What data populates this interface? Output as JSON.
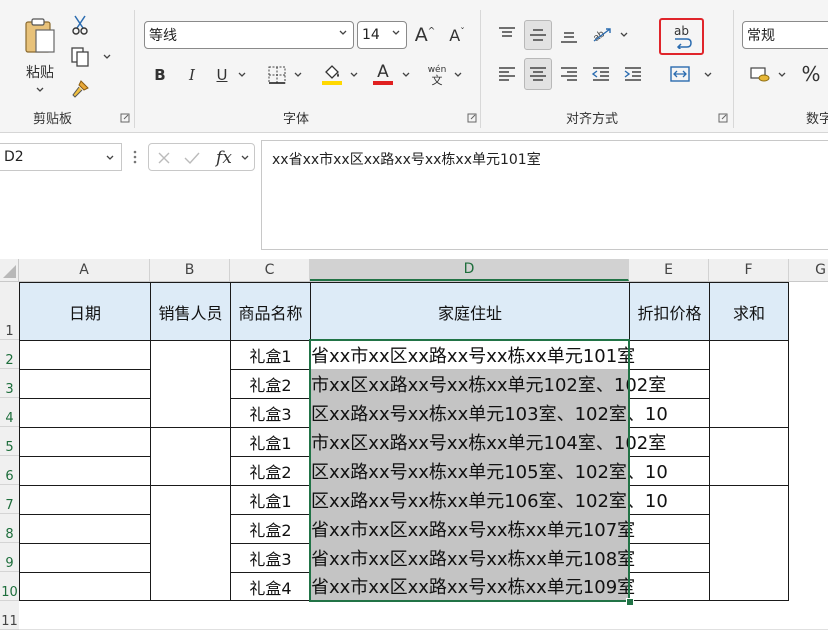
{
  "ribbon": {
    "clipboard": {
      "paste_label": "粘贴",
      "group_label": "剪贴板"
    },
    "font": {
      "font_name": "等线",
      "font_size": "14",
      "phonetic_top": "wén",
      "phonetic_bottom": "文",
      "group_label": "字体"
    },
    "alignment": {
      "wrap_text_icon_text": "ab",
      "group_label": "对齐方式"
    },
    "number": {
      "format": "常规",
      "group_label": "数字",
      "percent_label": "%"
    }
  },
  "formula_bar": {
    "name_box": "D2",
    "fx_label": "fx",
    "content": "xx省xx市xx区xx路xx号xx栋xx单元101室"
  },
  "colors": {
    "accent": "#217346",
    "highlight": "#e0252b",
    "header_fill": "#ddebf7",
    "selection_fill": "#c4c4c4"
  },
  "sheet": {
    "columns": [
      "A",
      "B",
      "C",
      "D",
      "E",
      "F",
      "G"
    ],
    "rows": [
      "1",
      "2",
      "3",
      "4",
      "5",
      "6",
      "7",
      "8",
      "9",
      "10",
      "11"
    ],
    "headers": {
      "date": "日期",
      "salesperson": "销售人员",
      "product": "商品名称",
      "address": "家庭住址",
      "discount": "折扣价格",
      "sum": "求和"
    },
    "products": [
      "礼盒1",
      "礼盒2",
      "礼盒3",
      "礼盒1",
      "礼盒2",
      "礼盒1",
      "礼盒2",
      "礼盒3",
      "礼盒4"
    ],
    "address_visible": [
      "省xx市xx区xx路xx号xx栋xx单元101室",
      "市xx区xx路xx号xx栋xx单元102室、102室",
      "区xx路xx号xx栋xx单元103室、102室、10",
      "市xx区xx路xx号xx栋xx单元104室、102室",
      "区xx路xx号xx栋xx单元105室、102室、10",
      "区xx路xx号xx栋xx单元106室、102室、10",
      "省xx市xx区xx路xx号xx栋xx单元107室",
      "省xx市xx区xx路xx号xx栋xx单元108室",
      "省xx市xx区xx路xx号xx栋xx单元109室"
    ]
  }
}
